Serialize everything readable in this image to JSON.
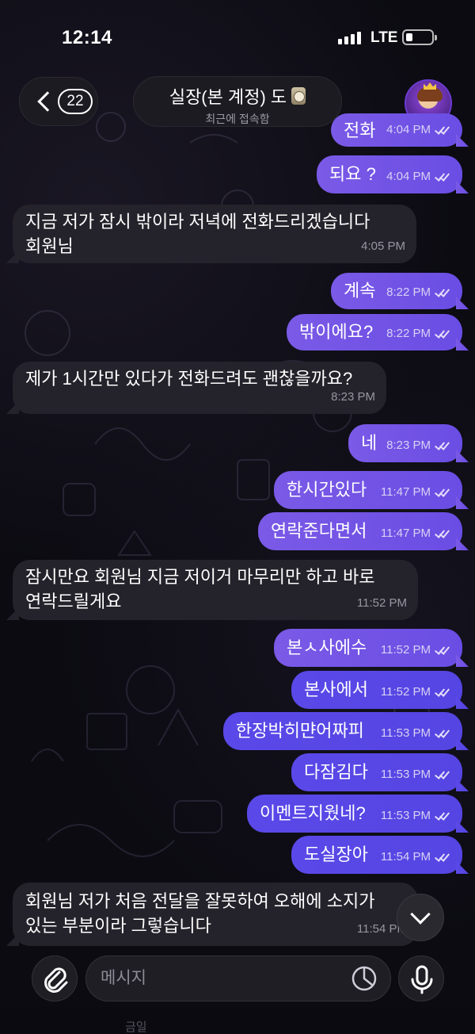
{
  "status": {
    "time": "12:14",
    "network": "LTE"
  },
  "header": {
    "back_count": "22",
    "contact_name": "실장(본 계정) 도",
    "contact_status": "최근에 접속함"
  },
  "messages": [
    {
      "side": "out",
      "text": "전화",
      "time": "4:04 PM"
    },
    {
      "side": "out",
      "text": "되요 ?",
      "time": "4:04 PM"
    },
    {
      "side": "in",
      "text": "지금 저가 잠시 밖이라 저녁에 전화드리겠습니다",
      "text2": "회원님",
      "time": "4:05 PM"
    },
    {
      "side": "out",
      "text": "계속",
      "time": "8:22 PM"
    },
    {
      "side": "out",
      "text": "밖이에요?",
      "time": "8:22 PM"
    },
    {
      "side": "in",
      "text": "제가 1시간만 있다가 전화드려도 괜찮을까요?",
      "time": "8:23 PM"
    },
    {
      "side": "out",
      "text": "네",
      "time": "8:23 PM"
    },
    {
      "side": "out",
      "text": "한시간있다",
      "time": "11:47 PM"
    },
    {
      "side": "out",
      "text": "연락준다면서",
      "time": "11:47 PM"
    },
    {
      "side": "in",
      "text": "잠시만요 회원님 지금 저이거 마무리만 하고 바로",
      "text2": "연락드릴게요",
      "time": "11:52 PM"
    },
    {
      "side": "out",
      "text": "본ㅅ사에수",
      "time": "11:52 PM"
    },
    {
      "side": "out",
      "text": "본사에서",
      "time": "11:52 PM"
    },
    {
      "side": "out",
      "text": "한장박히먄어짜피",
      "time": "11:53 PM"
    },
    {
      "side": "out",
      "text": "다잠김다",
      "time": "11:53 PM"
    },
    {
      "side": "out",
      "text": "이멘트지웠네?",
      "time": "11:53 PM"
    },
    {
      "side": "out",
      "text": "도실장아",
      "time": "11:54 PM"
    },
    {
      "side": "in",
      "text": "회원님 저가 처음 전달을 잘못하여 오해에 소지가",
      "text2": "있는 부분이라 그렇습니다",
      "time": "11:54 PM"
    }
  ],
  "composer": {
    "placeholder": "메시지"
  },
  "ghost_text": "금일",
  "colors": {
    "outgoing": "#6f52e5",
    "incoming": "#24232b",
    "background": "#0c0b12"
  }
}
